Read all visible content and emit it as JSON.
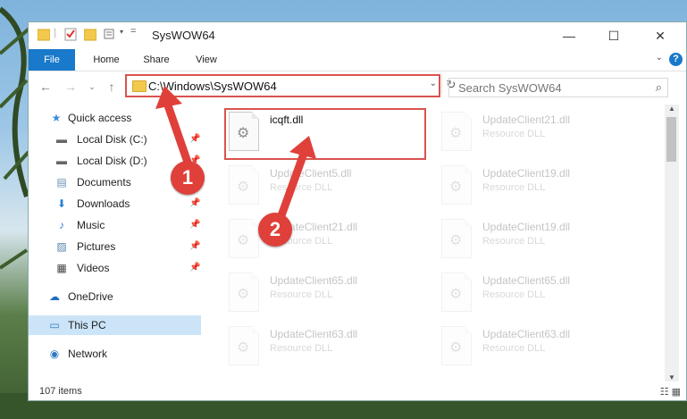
{
  "window": {
    "title": "SysWOW64",
    "minimize_icon": "minimize-icon",
    "maximize_icon": "maximize-icon",
    "close_icon": "close-icon"
  },
  "ribbon": {
    "tabs": [
      "File",
      "Home",
      "Share",
      "View"
    ],
    "help_label": "?"
  },
  "address_bar": {
    "path": "C:\\Windows\\SysWOW64",
    "search_placeholder": "Search SysWOW64"
  },
  "sidebar": {
    "items": [
      {
        "label": "Quick access",
        "icon": "star-icon",
        "pinned": false
      },
      {
        "label": "Local Disk (C:)",
        "icon": "drive-icon",
        "pinned": true
      },
      {
        "label": "Local Disk (D:)",
        "icon": "drive-icon",
        "pinned": true
      },
      {
        "label": "Documents",
        "icon": "documents-icon",
        "pinned": true
      },
      {
        "label": "Downloads",
        "icon": "downloads-icon",
        "pinned": true
      },
      {
        "label": "Music",
        "icon": "music-icon",
        "pinned": true
      },
      {
        "label": "Pictures",
        "icon": "pictures-icon",
        "pinned": true
      },
      {
        "label": "Videos",
        "icon": "videos-icon",
        "pinned": true
      },
      {
        "label": "OneDrive",
        "icon": "onedrive-icon",
        "pinned": false
      },
      {
        "label": "This PC",
        "icon": "computer-icon",
        "pinned": false,
        "selected": true
      },
      {
        "label": "Network",
        "icon": "network-icon",
        "pinned": false
      }
    ]
  },
  "files": [
    {
      "name": "icqft.dll",
      "type": ""
    },
    {
      "name": "UpdateClient21.dll",
      "type": "Resource DLL"
    },
    {
      "name": "UpdateClient5.dll",
      "type": "Resource DLL"
    },
    {
      "name": "UpdateClient19.dll",
      "type": "Resource DLL"
    },
    {
      "name": "UpdateClient21.dll",
      "type": "Resource DLL"
    },
    {
      "name": "UpdateClient19.dll",
      "type": "Resource DLL"
    },
    {
      "name": "UpdateClient65.dll",
      "type": "Resource DLL"
    },
    {
      "name": "UpdateClient65.dll",
      "type": "Resource DLL"
    },
    {
      "name": "UpdateClient63.dll",
      "type": "Resource DLL"
    },
    {
      "name": "UpdateClient63.dll",
      "type": "Resource DLL"
    }
  ],
  "status": {
    "item_count": "107 items"
  },
  "annotations": {
    "step1": "1",
    "step2": "2",
    "color": "#d9534f"
  }
}
